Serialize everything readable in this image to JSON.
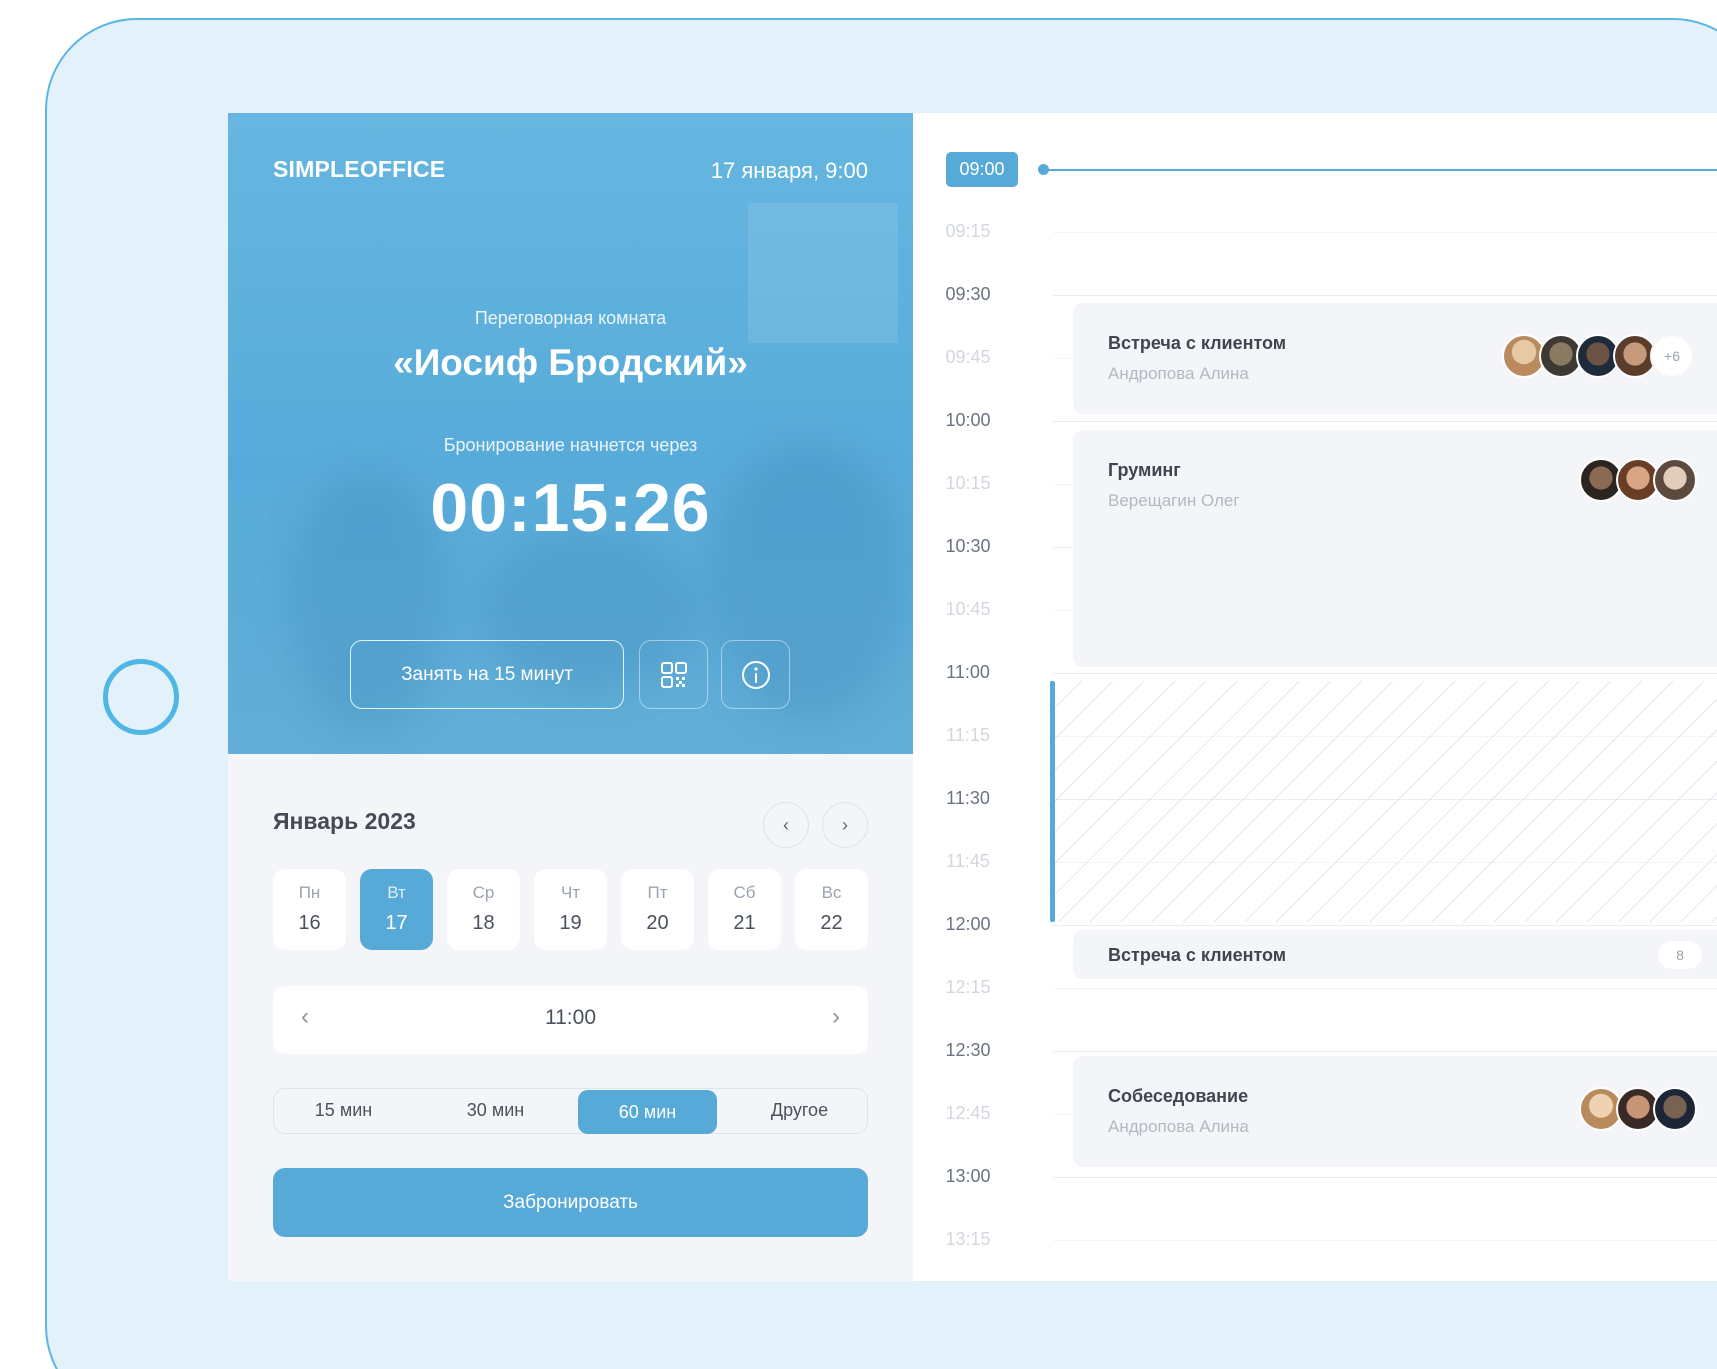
{
  "hero": {
    "brand": "SIMPLEOFFICE",
    "datetime": "17 января, 9:00",
    "room_caption": "Переговорная комната",
    "room_name": "«Иосиф Бродский»",
    "starts_caption": "Бронирование начнется через",
    "countdown": "00:15:26",
    "occupy_label": "Занять на 15 минут",
    "qr_icon": "qr-code-icon",
    "info_icon": "info-icon"
  },
  "calendar": {
    "month": "Январь 2023",
    "prev_icon": "chevron-left-icon",
    "next_icon": "chevron-right-icon",
    "days": [
      {
        "name": "Пн",
        "date": "16"
      },
      {
        "name": "Вт",
        "date": "17"
      },
      {
        "name": "Ср",
        "date": "18"
      },
      {
        "name": "Чт",
        "date": "19"
      },
      {
        "name": "Пт",
        "date": "20"
      },
      {
        "name": "Сб",
        "date": "21"
      },
      {
        "name": "Вс",
        "date": "22"
      }
    ],
    "selected_day": "17"
  },
  "time_picker": {
    "value": "11:00",
    "prev": "‹",
    "next": "›"
  },
  "durations": {
    "options": [
      "15 мин",
      "30 мин",
      "60 мин",
      "Другое"
    ],
    "selected": "60 мин"
  },
  "book_label": "Забронировать",
  "schedule": {
    "now": "09:00",
    "slots": [
      "09:00",
      "09:15",
      "09:30",
      "09:45",
      "10:00",
      "10:15",
      "10:30",
      "10:45",
      "11:00",
      "11:15",
      "11:30",
      "11:45",
      "12:00",
      "12:15",
      "12:30",
      "12:45",
      "13:00",
      "13:15"
    ],
    "events": [
      {
        "title": "Встреча с клиентом",
        "organizer": "Андропова Алина",
        "more": "+6"
      },
      {
        "title": "Груминг",
        "organizer": "Верещагин Олег"
      },
      {
        "title": "Встреча с клиентом",
        "count": "8"
      },
      {
        "title": "Собеседование",
        "organizer": "Андропова Алина"
      }
    ],
    "selection": {
      "start": "11:00",
      "end": "12:00"
    }
  },
  "colors": {
    "accent": "#57a9d8",
    "frame": "#5bb6e2",
    "frame_bg": "#e3f1fb",
    "panel_bg": "#f3f5f9"
  }
}
